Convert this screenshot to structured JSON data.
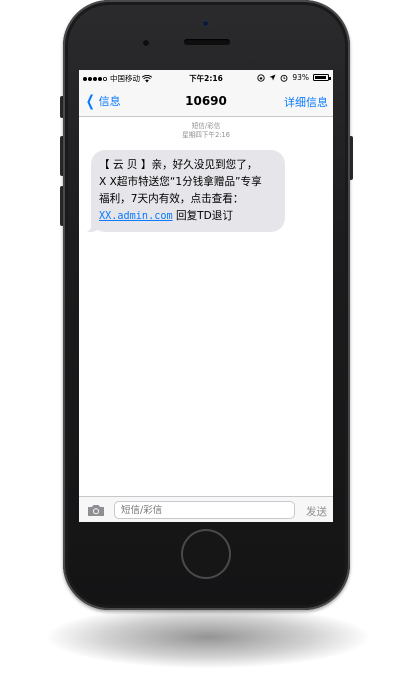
{
  "status_bar": {
    "carrier": "中国移动",
    "time": "下午2:16",
    "battery_text": "93%",
    "battery_level": 0.93,
    "signal_bars_filled": 4
  },
  "nav": {
    "back_label": "信息",
    "title": "10690",
    "details_label": "详细信息"
  },
  "thread": {
    "type_label": "短信/彩信",
    "timestamp": "星期四下午2:16"
  },
  "message": {
    "line1": "【 云 贝 】亲，好久没见到您了，",
    "line2": "X X超市特送您“1分钱拿赠品”专享",
    "line3": "福利，7天内有效，点击查看：",
    "link": "XX.admin.com",
    "suffix": " 回复TD退订"
  },
  "composer": {
    "placeholder": "短信/彩信",
    "send_label": "发送"
  },
  "colors": {
    "accent": "#0a7aff",
    "bubble": "#e5e5ea",
    "bar": "#f7f7f7"
  },
  "icons": [
    "camera-icon",
    "wifi-icon",
    "lock-rotation-icon",
    "location-icon",
    "alarm-icon",
    "battery-icon",
    "chevron-left-icon"
  ]
}
